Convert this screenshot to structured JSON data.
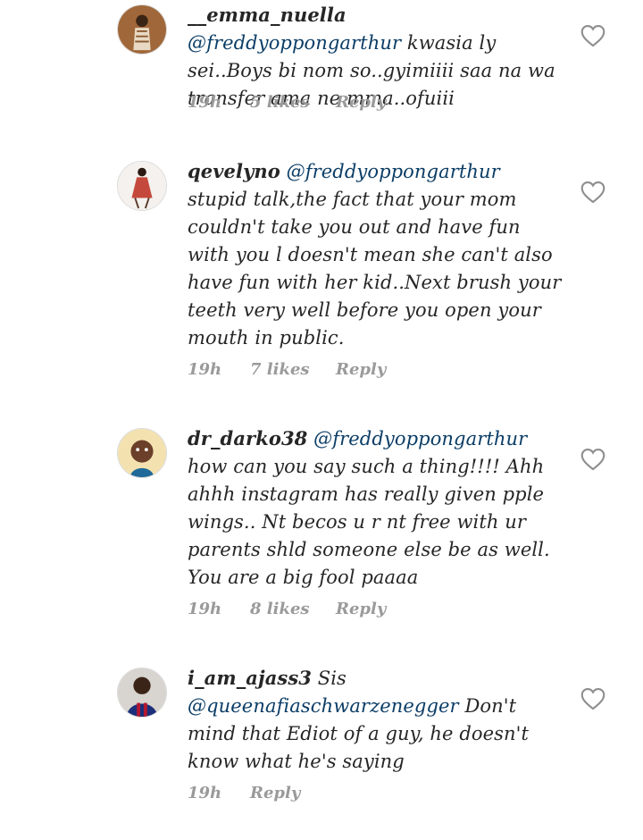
{
  "comments": [
    {
      "username": "__emma_nuella",
      "mention": "@freddyoppongarthur",
      "text": " kwasia ly sei..Boys bi nom so..gyimiiii saa na wa transfer ama ne mma..ofuiii",
      "time": "19h",
      "likes": "5 likes",
      "reply": "Reply"
    },
    {
      "username": "qevelyno",
      "mention": "@freddyoppongarthur",
      "text": " stupid talk,the fact that your mom couldn't take you out and have fun with you l doesn't mean she can't also have fun with her kid..Next brush your teeth very well before you open your mouth in public.",
      "time": "19h",
      "likes": "7 likes",
      "reply": "Reply"
    },
    {
      "username": "dr_darko38",
      "mention": "@freddyoppongarthur",
      "text": " how can you say such a thing!!!! Ahh ahhh instagram has really given pple wings.. Nt becos u r nt free with ur parents shld someone else be as well. You are a big fool paaaa",
      "time": "19h",
      "likes": "8 likes",
      "reply": "Reply"
    },
    {
      "username": "i_am_ajass3",
      "prefix": " Sis",
      "mention": "@queenafiaschwarzenegger",
      "text": " Don't mind that Ediot of a guy, he doesn't know what he's saying",
      "time": "19h",
      "reply": "Reply"
    }
  ],
  "icons": {
    "like": "heart-outline-icon"
  },
  "colors": {
    "mention": "#0b3d66",
    "meta": "#9a9a9a",
    "text": "#262626"
  }
}
